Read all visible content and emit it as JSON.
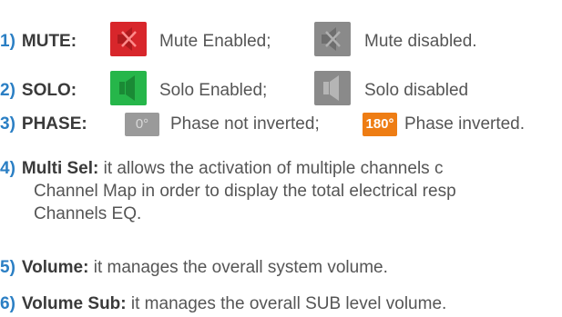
{
  "items": [
    {
      "number": "1)",
      "label": "MUTE:",
      "enabled_text": "Mute Enabled;",
      "disabled_text": "Mute disabled.",
      "enabled_icon": "speaker-mute-icon",
      "disabled_icon": "speaker-mute-icon"
    },
    {
      "number": "2)",
      "label": "SOLO:",
      "enabled_text": "Solo Enabled;",
      "disabled_text": "Solo disabled",
      "enabled_icon": "speaker-solo-icon",
      "disabled_icon": "speaker-solo-icon"
    },
    {
      "number": "3)",
      "label": "PHASE:",
      "off_button": "0°",
      "off_text": "Phase not inverted;",
      "on_button": "180°",
      "on_text": "Phase inverted."
    },
    {
      "number": "4)",
      "label": "Multi Sel:",
      "line1": "it allows the activation of multiple channels c",
      "line2": "Channel Map in order to display the total electrical resp",
      "line3": "Channels EQ."
    },
    {
      "number": "5)",
      "label": "Volume:",
      "text": "it manages the overall system volume."
    },
    {
      "number": "6)",
      "label": "Volume Sub:",
      "text": "it manages the overall SUB level volume."
    }
  ],
  "colors": {
    "number": "#2b7fc4",
    "mute_enabled": "#d8262b",
    "solo_enabled": "#26b64a",
    "disabled": "#8a8a8a",
    "phase_inverted": "#ee7d14"
  }
}
